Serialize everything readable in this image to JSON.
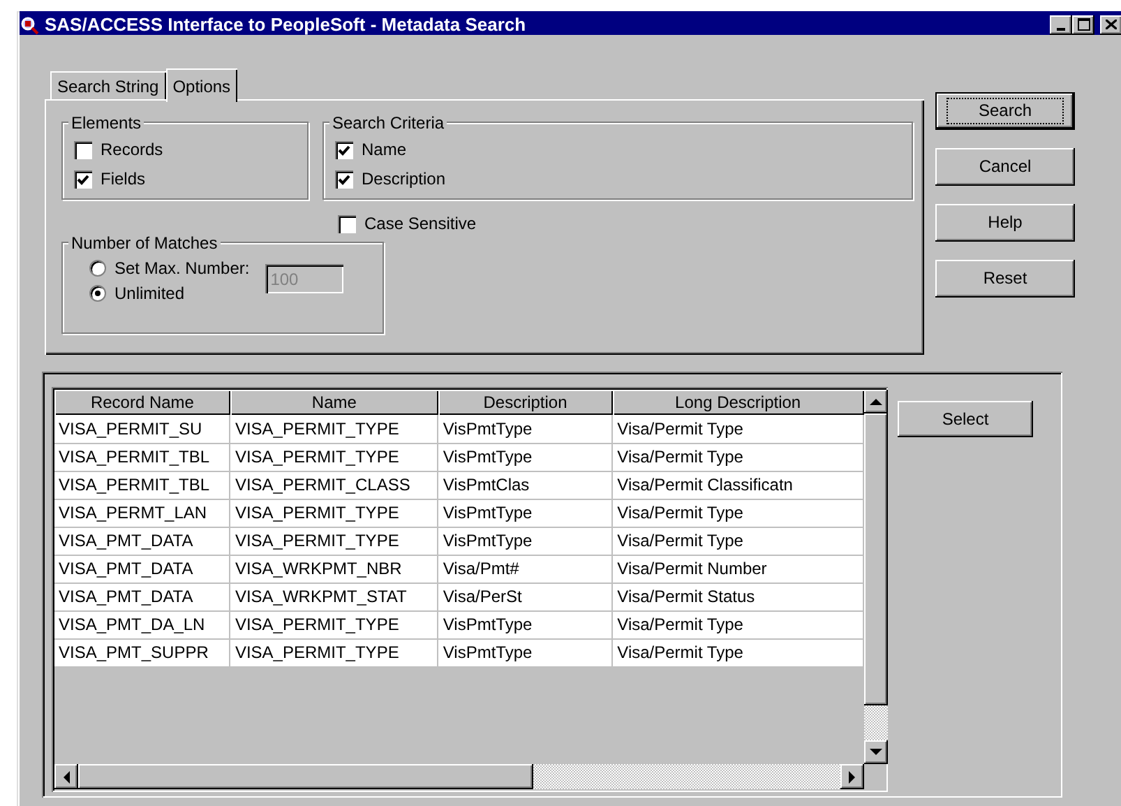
{
  "window": {
    "title": "SAS/ACCESS Interface to PeopleSoft - Metadata Search"
  },
  "tabs": [
    {
      "label": "Search String",
      "selected": false
    },
    {
      "label": "Options",
      "selected": true
    }
  ],
  "elements": {
    "label": "Elements",
    "options": [
      {
        "label": "Records",
        "checked": false
      },
      {
        "label": "Fields",
        "checked": true
      }
    ]
  },
  "search_criteria": {
    "label": "Search Criteria",
    "options": [
      {
        "label": "Name",
        "checked": true
      },
      {
        "label": "Description",
        "checked": true
      }
    ]
  },
  "case_sensitive": {
    "label": "Case Sensitive",
    "checked": false
  },
  "number_of_matches": {
    "label": "Number of Matches",
    "options": [
      {
        "label": "Set Max. Number:",
        "selected": false
      },
      {
        "label": "Unlimited",
        "selected": true
      }
    ],
    "max_number": {
      "value": "100",
      "disabled": true
    }
  },
  "buttons": [
    {
      "label": "Search",
      "default": true
    },
    {
      "label": "Cancel",
      "default": false
    },
    {
      "label": "Help",
      "default": false
    },
    {
      "label": "Reset",
      "default": false
    }
  ],
  "table": {
    "columns": [
      "Record Name",
      "Name",
      "Description",
      "Long Description"
    ],
    "rows": [
      [
        "VISA_PERMIT_SU",
        "VISA_PERMIT_TYPE",
        "VisPmtType",
        "Visa/Permit Type"
      ],
      [
        "VISA_PERMIT_TBL",
        "VISA_PERMIT_TYPE",
        "VisPmtType",
        "Visa/Permit Type"
      ],
      [
        "VISA_PERMIT_TBL",
        "VISA_PERMIT_CLASS",
        "VisPmtClas",
        "Visa/Permit Classificatn"
      ],
      [
        "VISA_PERMT_LAN",
        "VISA_PERMIT_TYPE",
        "VisPmtType",
        "Visa/Permit Type"
      ],
      [
        "VISA_PMT_DATA",
        "VISA_PERMIT_TYPE",
        "VisPmtType",
        "Visa/Permit Type"
      ],
      [
        "VISA_PMT_DATA",
        "VISA_WRKPMT_NBR",
        "Visa/Pmt#",
        "Visa/Permit Number"
      ],
      [
        "VISA_PMT_DATA",
        "VISA_WRKPMT_STAT",
        "Visa/PerSt",
        "Visa/Permit Status"
      ],
      [
        "VISA_PMT_DA_LN",
        "VISA_PERMIT_TYPE",
        "VisPmtType",
        "Visa/Permit Type"
      ],
      [
        "VISA_PMT_SUPPR",
        "VISA_PERMIT_TYPE",
        "VisPmtType",
        "Visa/Permit Type"
      ]
    ]
  },
  "select_button": {
    "label": "Select"
  }
}
